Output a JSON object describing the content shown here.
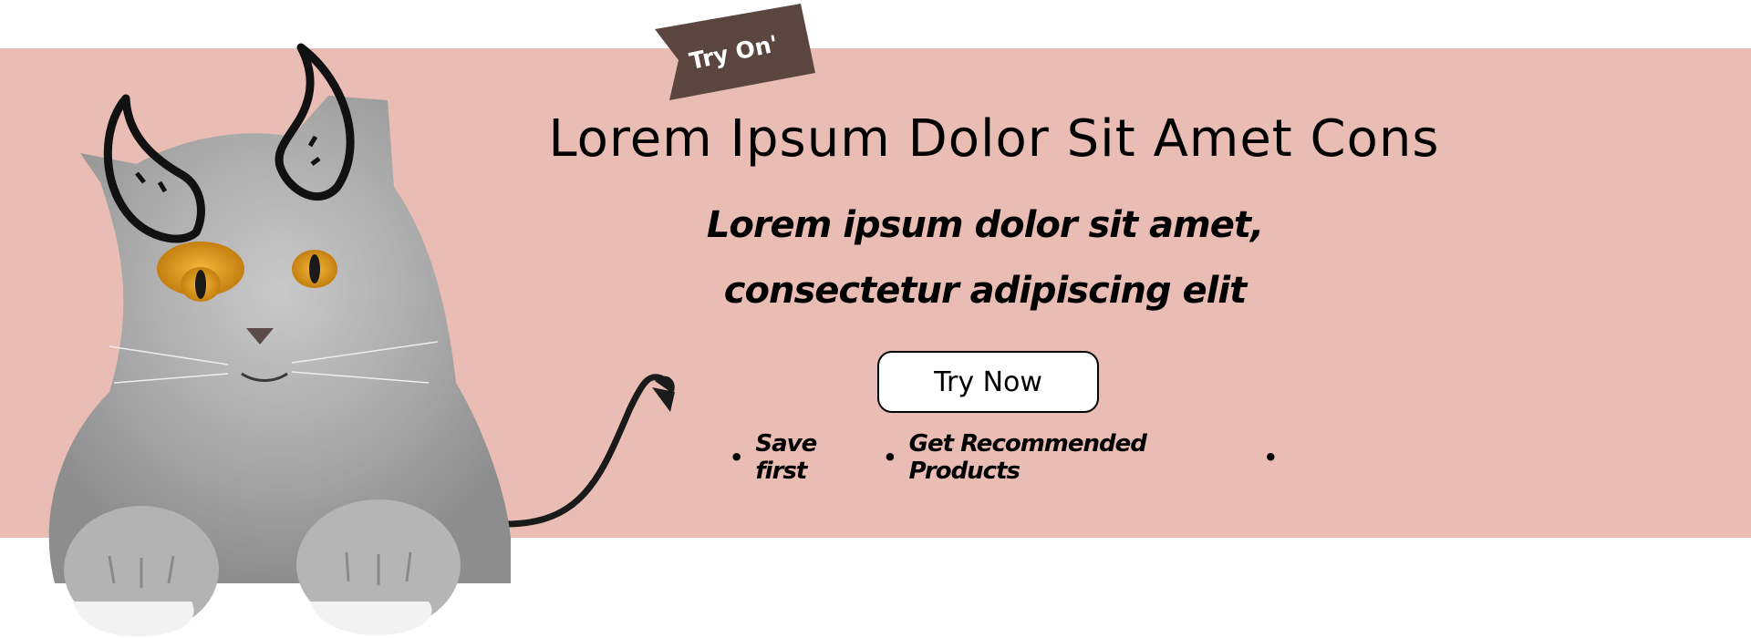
{
  "colors": {
    "banner_bg": "#e9bdb4",
    "tag_bg": "#5b463f",
    "text": "#000000",
    "button_bg": "#ffffff"
  },
  "tag": {
    "label": "Try On'"
  },
  "headline": "Lorem Ipsum Dolor Sit Amet Cons",
  "subline": {
    "line1": "Lorem ipsum dolor sit amet,",
    "line2": "consectetur adipiscing elit"
  },
  "cta": {
    "label": "Try Now"
  },
  "bullets": {
    "items": [
      "Save first",
      "Get Recommended Products"
    ],
    "separator": "•"
  },
  "illustration": {
    "subject": "grey-cat",
    "decorations": [
      "devil-horns",
      "devil-tail"
    ]
  }
}
